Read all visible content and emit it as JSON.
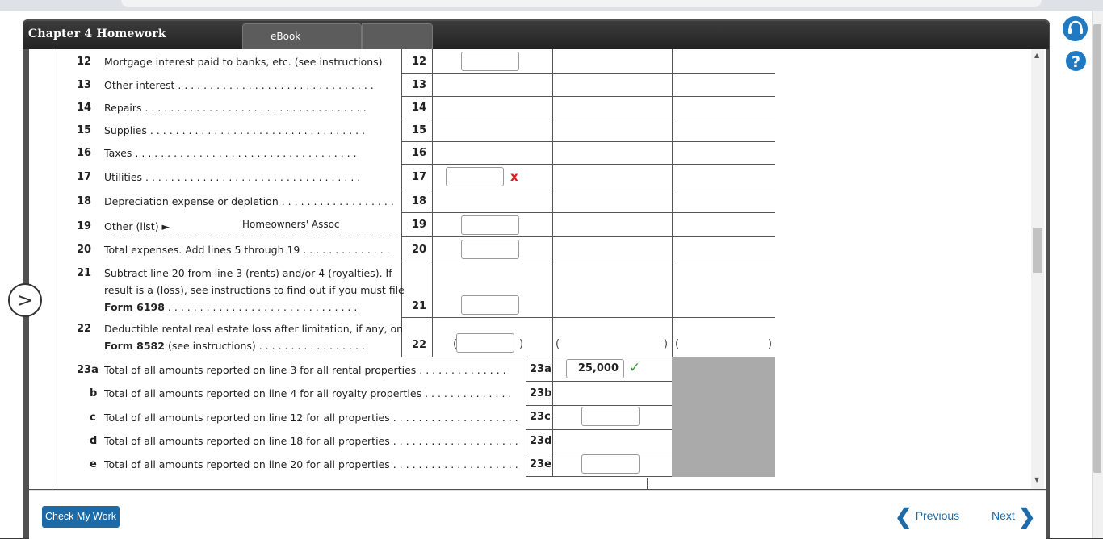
{
  "header": {
    "title": "Chapter 4 Homework",
    "tab_ebook": "eBook"
  },
  "rows": [
    {
      "num": "12",
      "label": "Mortgage interest paid to banks, etc. (see instructions)",
      "line": "12"
    },
    {
      "num": "13",
      "label": "Other interest",
      "line": "13"
    },
    {
      "num": "14",
      "label": "Repairs",
      "line": "14"
    },
    {
      "num": "15",
      "label": "Supplies",
      "line": "15"
    },
    {
      "num": "16",
      "label": "Taxes",
      "line": "16"
    },
    {
      "num": "17",
      "label": "Utilities",
      "line": "17"
    },
    {
      "num": "18",
      "label": "Depreciation expense or depletion",
      "line": "18"
    },
    {
      "num": "19",
      "label": "Other (list) ►",
      "line": "19",
      "other_text": "Homeowners' Assoc"
    },
    {
      "num": "20",
      "label": "Total expenses. Add lines 5 through 19",
      "line": "20"
    },
    {
      "num": "21",
      "label_1": "Subtract line 20 from line 3 (rents) and/or 4 (royalties). If",
      "label_2": "result is a (loss), see instructions to find out if you must file",
      "label_3_bold": "Form 6198",
      "line": "21"
    },
    {
      "num": "22",
      "label_1": "Deductible rental real estate loss after limitation, if any, on",
      "label_2_bold": "Form 8582",
      "label_2_rest": "(see instructions)",
      "line": "22"
    }
  ],
  "totals": [
    {
      "num": "23a",
      "label": "Total of all amounts reported on line 3 for all rental properties",
      "line": "23a",
      "value": "25,000"
    },
    {
      "num": "b",
      "label": "Total of all amounts reported on line 4 for all royalty properties",
      "line": "23b"
    },
    {
      "num": "c",
      "label": "Total of all amounts reported on line 12 for all properties",
      "line": "23c"
    },
    {
      "num": "d",
      "label": "Total of all amounts reported on line 18 for all properties",
      "line": "23d"
    },
    {
      "num": "e",
      "label": "Total of all amounts reported on line 20 for all properties",
      "line": "23e"
    }
  ],
  "status": {
    "incorrect_mark": "x",
    "correct_mark": "✓"
  },
  "footer": {
    "check_my_work": "Check My Work",
    "previous": "Previous",
    "next": "Next"
  },
  "icons": {
    "support": "headset-icon",
    "help": "help-icon",
    "side_arrow": "chevron-right-icon"
  },
  "colors": {
    "accent": "#1c6aa7",
    "header_bg": "#2e2e2e",
    "error": "#e0191a",
    "success": "#3a9a3a"
  }
}
